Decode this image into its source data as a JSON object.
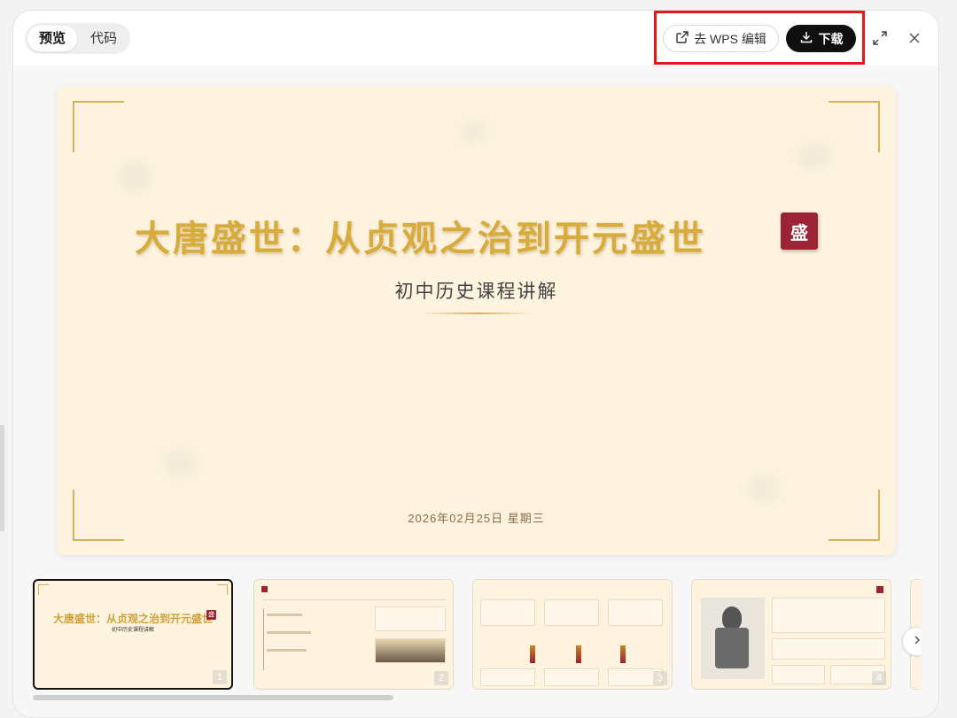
{
  "header": {
    "tabs": [
      {
        "label": "预览",
        "active": true
      },
      {
        "label": "代码",
        "active": false
      }
    ],
    "wps_button": "去 WPS 编辑",
    "download_button": "下载",
    "icons": [
      "external-link-icon",
      "download-icon",
      "expand-icon",
      "close-icon"
    ]
  },
  "slide": {
    "title": "大唐盛世：从贞观之治到开元盛世",
    "seal": "盛",
    "subtitle": "初中历史课程讲解",
    "date": "2026年02月25日 星期三"
  },
  "thumbnails": [
    {
      "num": "1",
      "title": "大唐盛世：从贞观之治到开元盛世",
      "seal": "盛",
      "subtitle": "初中历史课程讲解"
    },
    {
      "num": "2"
    },
    {
      "num": "3"
    },
    {
      "num": "4"
    }
  ],
  "colors": {
    "accent_gold": "#d7ac3c",
    "seal_red": "#9b2335",
    "slide_bg": "#fdf3df",
    "highlight": "#e21818"
  }
}
